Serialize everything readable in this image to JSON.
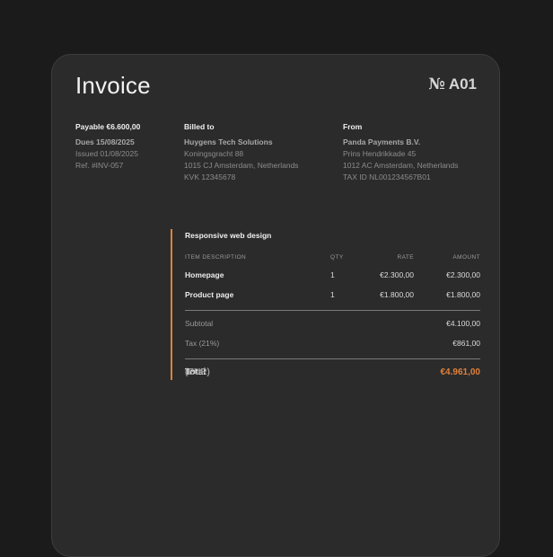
{
  "invoice": {
    "title": "Invoice",
    "number_prefix": "№",
    "number": "A01"
  },
  "summary": {
    "payable": "Payable €6.600,00",
    "dues": "Dues 15/08/2025",
    "issued": "Issued 01/08/2025",
    "ref": "Ref. #INV-057"
  },
  "billed_to": {
    "heading": "Billed to",
    "name": "Huygens Tech Solutions",
    "address1": "Koningsgracht 88",
    "address2": "1015 CJ Amsterdam, Netherlands",
    "id": "KVK 12345678"
  },
  "from": {
    "heading": "From",
    "name": "Panda Payments B.V.",
    "address1": "Prins Hendrikkade 45",
    "address2": "1012 AC Amsterdam, Netherlands",
    "id": "TAX ID NL001234567B01"
  },
  "items": {
    "section_title": "Responsive web design",
    "columns": {
      "description": "ITEM DESCRIPTION",
      "qty": "QTY",
      "rate": "RATE",
      "amount": "AMOUNT"
    },
    "rows": [
      {
        "description": "Homepage",
        "qty": "1",
        "rate": "€2.300,00",
        "amount": "€2.300,00"
      },
      {
        "description": "Product page",
        "qty": "1",
        "rate": "€1.800,00",
        "amount": "€1.800,00"
      }
    ]
  },
  "totals": {
    "subtotal_label": "Subtotal",
    "subtotal_value": "€4.100,00",
    "tax_label": "Tax (21%)",
    "tax_value": "€861,00",
    "total_label": "Total",
    "total_currency": "(EUR)",
    "total_value": "€4.961,00"
  },
  "colors": {
    "accent": "#e0803a",
    "background": "#1b1b1b",
    "card": "#2b2b2b"
  }
}
